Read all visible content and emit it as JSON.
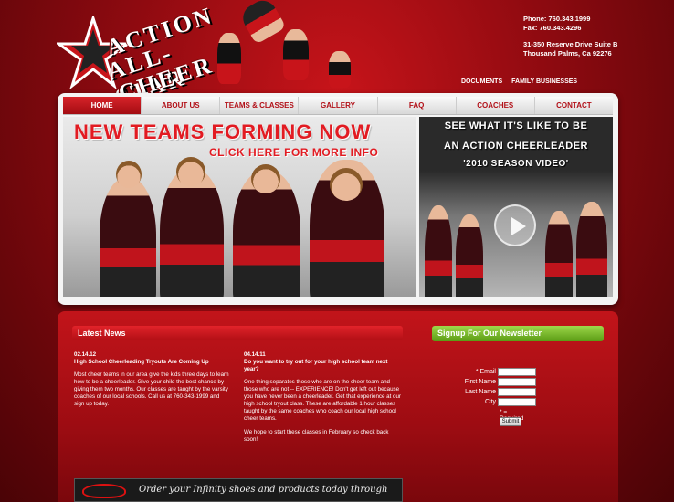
{
  "header": {
    "logo_words": [
      "ACTION",
      "ALL-STAR",
      "CHEER"
    ],
    "phone": "Phone: 760.343.1999",
    "fax": "Fax: 760.343.4296",
    "address_line1": "31-350 Reserve Drive Suite B",
    "address_line2": "Thousand Palms, Ca 92276",
    "util_links": [
      "DOCUMENTS",
      "FAMILY BUSINESSES"
    ]
  },
  "nav": {
    "items": [
      "HOME",
      "ABOUT US",
      "TEAMS & CLASSES",
      "GALLERY",
      "FAQ",
      "COACHES",
      "CONTACT"
    ],
    "active": "HOME"
  },
  "banner": {
    "headline": "NEW TEAMS FORMING NOW",
    "sub": "CLICK HERE FOR MORE INFO"
  },
  "video": {
    "line1": "SEE WHAT IT'S LIKE TO BE",
    "line2": "AN ACTION CHEERLEADER",
    "line3": "'2010 SEASON VIDEO'"
  },
  "news": {
    "heading": "Latest News",
    "items": [
      {
        "date": "02.14.12",
        "title": "High School Cheerleading Tryouts Are Coming Up",
        "paragraphs": [
          "Most cheer teams in our area give the kids three days to learn how to be a cheerleader. Give your child the best chance by giving them two months. Our classes are taught by the varsity coaches of our local schools. Call us at 760-343-1999 and sign up today."
        ]
      },
      {
        "date": "04.14.11",
        "title": "Do you want to try out for your high school team next year?",
        "paragraphs": [
          "One thing separates those who are on the cheer team and those who are not -- EXPERIENCE! Don't get left out because you have never been a cheerleader. Get that experience at our high school tryout class. These are affordable 1 hour classes taught by the same coaches who coach our local high school cheer teams.",
          "We hope to start these classes in February so check back soon!"
        ]
      }
    ]
  },
  "promo": {
    "text": "Order your Infinity shoes and products today through"
  },
  "newsletter": {
    "heading": "Signup For Our Newsletter",
    "fields": [
      "* Email",
      "First Name",
      "Last Name",
      "City"
    ],
    "required_note": "* = Required Field",
    "submit_label": "Submit"
  },
  "colors": {
    "brand_red": "#c8141a",
    "accent_green": "#7ac02e",
    "panel_bg": "#f4f4f4"
  }
}
